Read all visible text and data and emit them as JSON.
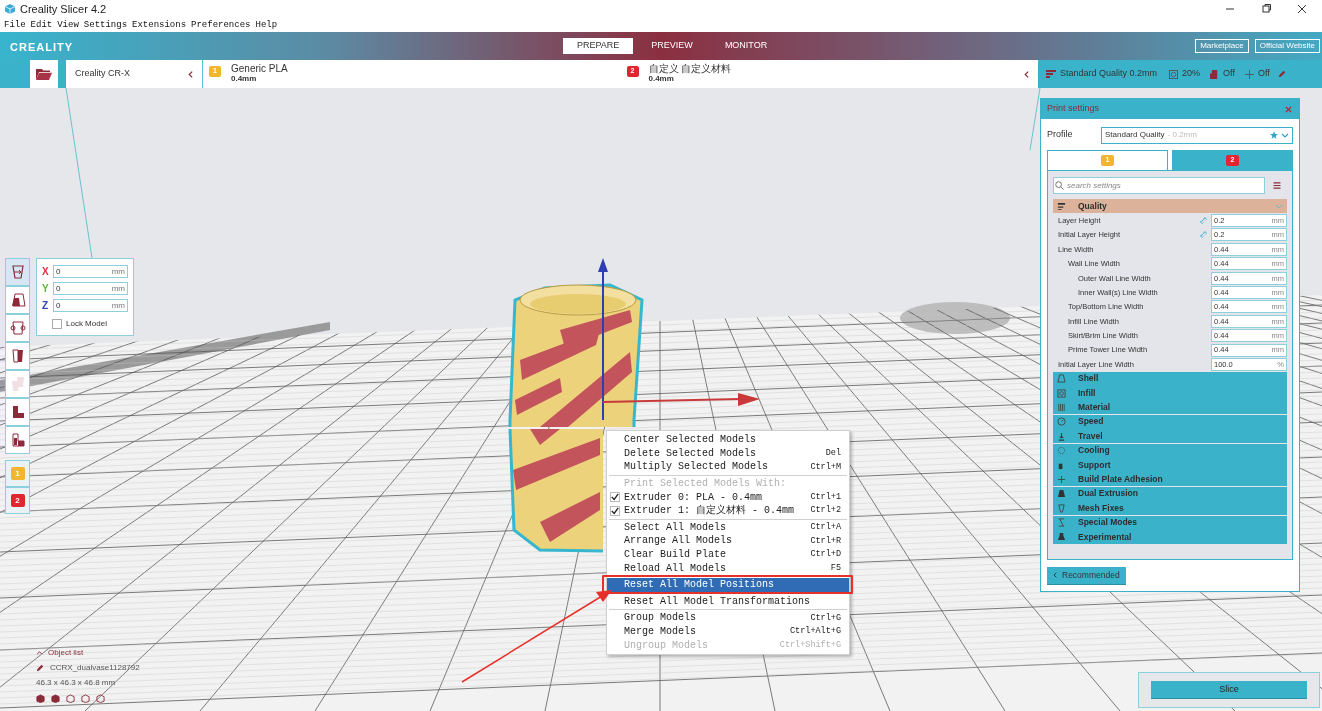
{
  "window": {
    "title": "Creality Slicer 4.2"
  },
  "menu": [
    "File",
    "Edit",
    "View",
    "Settings",
    "Extensions",
    "Preferences",
    "Help"
  ],
  "header": {
    "logo": "CREALITY",
    "tabs": [
      {
        "label": "PREPARE",
        "selected": true
      },
      {
        "label": "PREVIEW",
        "selected": false
      },
      {
        "label": "MONITOR",
        "selected": false
      }
    ],
    "links": [
      "Marketplace",
      "Official Website"
    ]
  },
  "printer": {
    "name": "Creality CR-X"
  },
  "extruders": [
    {
      "number": "1",
      "material": "Generic PLA",
      "nozzle": "0.4mm",
      "color": "#f2b52e"
    },
    {
      "number": "2",
      "material": "自定义 自定义材料",
      "nozzle": "0.4mm",
      "color": "#e0262f"
    }
  ],
  "print_summary": {
    "profile": "Standard Quality 0.2mm",
    "infill": "20%",
    "support": "Off",
    "adhesion": "Off"
  },
  "extruder_buttons": [
    {
      "number": "1",
      "color": "#f2b52e"
    },
    {
      "number": "2",
      "color": "#e0262f"
    }
  ],
  "tools": [
    {
      "kind": "move",
      "selected": true,
      "disabled": false
    },
    {
      "kind": "scale",
      "selected": false,
      "disabled": false
    },
    {
      "kind": "rotate",
      "selected": false,
      "disabled": false
    },
    {
      "kind": "mirror",
      "selected": false,
      "disabled": false
    },
    {
      "kind": "multiply",
      "selected": false,
      "disabled": true
    },
    {
      "kind": "support",
      "selected": false,
      "disabled": false
    },
    {
      "kind": "blocker",
      "selected": false,
      "disabled": false
    }
  ],
  "move_panel": {
    "fields": [
      {
        "axis": "X",
        "value": "0",
        "unit": "mm",
        "color": "#e0303a"
      },
      {
        "axis": "Y",
        "value": "0",
        "unit": "mm",
        "color": "#5cb832"
      },
      {
        "axis": "Z",
        "value": "0",
        "unit": "mm",
        "color": "#2f48b5"
      }
    ],
    "lock": {
      "label": "Lock Model",
      "checked": false
    }
  },
  "print_settings": {
    "title": "Print settings",
    "profile_label": "Profile",
    "profile": "Standard Quality",
    "profile_detail": "- 0.2mm",
    "extruder_tabs": [
      {
        "number": "1",
        "selected": true
      },
      {
        "number": "2",
        "selected": false
      }
    ],
    "search_placeholder": "search settings",
    "categories": [
      {
        "label": "Quality",
        "expanded": true,
        "settings": [
          {
            "label": "Layer Height",
            "value": "0.2",
            "unit": "mm",
            "linked": true
          },
          {
            "label": "Initial Layer Height",
            "value": "0.2",
            "unit": "mm",
            "linked": true
          },
          {
            "label": "Line Width",
            "value": "0.44",
            "unit": "mm",
            "linked": false,
            "children": [
              {
                "label": "Wall Line Width",
                "value": "0.44",
                "unit": "mm",
                "linked": false,
                "children": [
                  {
                    "label": "Outer Wall Line Width",
                    "value": "0.44",
                    "unit": "mm",
                    "linked": false
                  },
                  {
                    "label": "Inner Wall(s) Line Width",
                    "value": "0.44",
                    "unit": "mm",
                    "linked": false
                  }
                ]
              },
              {
                "label": "Top/Bottom Line Width",
                "value": "0.44",
                "unit": "mm",
                "linked": false
              },
              {
                "label": "Infill Line Width",
                "value": "0.44",
                "unit": "mm",
                "linked": false
              },
              {
                "label": "Skirt/Brim Line Width",
                "value": "0.44",
                "unit": "mm",
                "linked": false
              },
              {
                "label": "Prime Tower Line Width",
                "value": "0.44",
                "unit": "mm",
                "linked": false
              }
            ]
          },
          {
            "label": "Initial Layer Line Width",
            "value": "100.0",
            "unit": "%",
            "linked": false
          }
        ]
      },
      {
        "label": "Shell",
        "expanded": false
      },
      {
        "label": "Infill",
        "expanded": false
      },
      {
        "label": "Material",
        "expanded": false
      },
      {
        "label": "Speed",
        "expanded": false
      },
      {
        "label": "Travel",
        "expanded": false
      },
      {
        "label": "Cooling",
        "expanded": false
      },
      {
        "label": "Support",
        "expanded": false
      },
      {
        "label": "Build Plate Adhesion",
        "expanded": false
      },
      {
        "label": "Dual Extrusion",
        "expanded": false
      },
      {
        "label": "Mesh Fixes",
        "expanded": false
      },
      {
        "label": "Special Modes",
        "expanded": false
      },
      {
        "label": "Experimental",
        "expanded": false
      }
    ],
    "mode_button": "Recommended"
  },
  "context_menu": [
    {
      "kind": "item",
      "label": "Center Selected Models",
      "disabled": false,
      "selected": false
    },
    {
      "kind": "item",
      "label": "Delete Selected Models",
      "shortcut": "Del",
      "disabled": false,
      "selected": false
    },
    {
      "kind": "item",
      "label": "Multiply Selected Models",
      "shortcut": "Ctrl+M",
      "disabled": false,
      "selected": false
    },
    {
      "kind": "separator"
    },
    {
      "kind": "item",
      "label": "Print Selected Models With:",
      "disabled": true,
      "selected": false
    },
    {
      "kind": "check",
      "label": "Extruder 0: PLA - 0.4mm",
      "shortcut": "Ctrl+1",
      "checked": true,
      "disabled": false,
      "selected": false
    },
    {
      "kind": "check",
      "label": "Extruder 1: 自定义材料 - 0.4mm",
      "shortcut": "Ctrl+2",
      "checked": true,
      "disabled": false,
      "selected": false
    },
    {
      "kind": "separator"
    },
    {
      "kind": "item",
      "label": "Select All Models",
      "shortcut": "Ctrl+A",
      "disabled": false,
      "selected": false
    },
    {
      "kind": "item",
      "label": "Arrange All Models",
      "shortcut": "Ctrl+R",
      "disabled": false,
      "selected": false
    },
    {
      "kind": "item",
      "label": "Clear Build Plate",
      "shortcut": "Ctrl+D",
      "disabled": false,
      "selected": false
    },
    {
      "kind": "item",
      "label": "Reload All Models",
      "shortcut": "F5",
      "disabled": false,
      "selected": false
    },
    {
      "kind": "item",
      "label": "Reset All Model Positions",
      "disabled": false,
      "selected": true
    },
    {
      "kind": "item",
      "label": "Reset All Model Transformations",
      "disabled": false,
      "selected": false
    },
    {
      "kind": "separator"
    },
    {
      "kind": "item",
      "label": "Group Models",
      "shortcut": "Ctrl+G",
      "disabled": false,
      "selected": false
    },
    {
      "kind": "item",
      "label": "Merge Models",
      "shortcut": "Ctrl+Alt+G",
      "disabled": false,
      "selected": false
    },
    {
      "kind": "item",
      "label": "Ungroup Models",
      "shortcut": "Ctrl+Shift+G",
      "disabled": true,
      "selected": false
    }
  ],
  "object_list": {
    "title": "Object list",
    "object": "CCRX_dualvase1128792",
    "dimensions": "46.3 x 46.3 x 46.8 mm"
  },
  "slice_button": "Slice"
}
